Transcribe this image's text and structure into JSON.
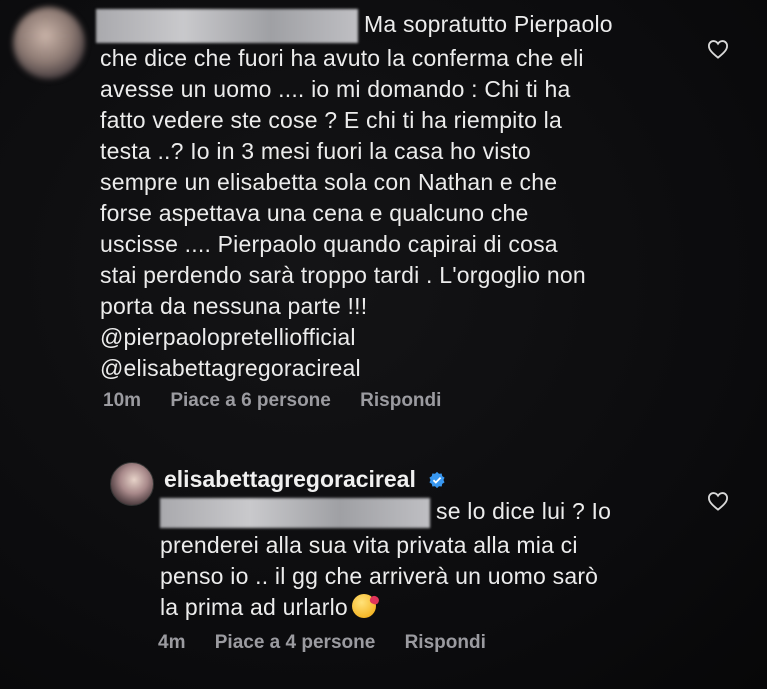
{
  "comment1": {
    "lines": [
      "Ma sopratutto Pierpaolo",
      "che dice che fuori ha avuto la conferma che eli",
      "avesse un uomo .... io mi domando :  Chi ti ha",
      "fatto vedere ste cose ? E chi ti ha riempito la",
      "testa ..? Io in 3 mesi fuori la casa ho visto",
      "sempre un elisabetta sola con Nathan e che",
      "forse aspettava una cena e qualcuno che",
      "uscisse .... Pierpaolo quando capirai di cosa",
      "stai perdendo sarà troppo tardi . L'orgoglio non",
      "porta da nessuna parte !!!",
      "@pierpaolopretelliofficial",
      "@elisabettagregoracireal"
    ],
    "time": "10m",
    "likes": "Piace a 6 persone",
    "reply": "Rispondi"
  },
  "comment2": {
    "username": "elisabettagregoracireal",
    "lines": [
      "se lo dice lui ? Io",
      "prenderei alla sua vita privata alla mia ci",
      "penso io .. il gg che arriverà un uomo sarò",
      "la prima ad urlarlo"
    ],
    "time": "4m",
    "likes": "Piace a 4 persone",
    "reply": "Rispondi"
  },
  "icons": {
    "like": "heart-outline-icon",
    "verified": "verified-badge-icon",
    "emoji": "kissing-face-emoji"
  },
  "colors": {
    "background": "#0c0c0e",
    "text": "#ececec",
    "meta": "#9b9ba0",
    "verified": "#3897f0"
  }
}
